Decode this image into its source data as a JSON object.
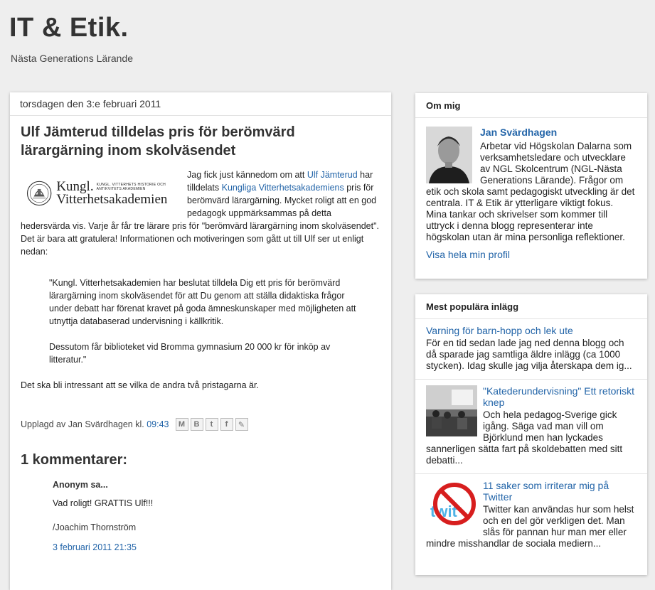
{
  "blog": {
    "title": "IT & Etik.",
    "description": "Nästa Generations Lärande"
  },
  "post": {
    "date": "torsdagen den 3:e februari 2011",
    "title": "Ulf Jämterud tilldelas pris för berömvärd lärargärning inom skolväsendet",
    "logo": {
      "line1": "Kungl.",
      "line1_small": "KUNGL. VITTERHETS HISTORIE OCH ANTIKVITETS AKADEMIEN",
      "line2": "Vitterhetsakademien"
    },
    "intro_1": "Jag fick just kännedom om att ",
    "link_ulf": "Ulf Jämterud",
    "intro_2": " har tilldelats ",
    "link_akademien": "Kungliga Vitterhetsakademiens",
    "intro_3": " pris för berömvärd lärargärning. Mycket roligt att en god pedagogk uppmärksammas på detta hedersvärda vis. Varje år får tre lärare pris för \"berömvärd lärargärning inom skolväsendet\". Det är bara att gratulera! Informationen och motiveringen som gått ut till Ulf ser ut enligt nedan:",
    "quote_1": "\"Kungl. Vitterhetsakademien har beslutat tilldela Dig ett pris för berömvärd lärargärning inom skolväsendet för att Du genom att ställa didaktiska frågor under debatt har förenat kravet på goda ämneskunskaper med möjligheten att utnyttja databaserad undervisning i källkritik.",
    "quote_2": "Dessutom får biblioteket vid Bromma gymnasium 20 000 kr för inköp av litteratur.\"",
    "after_quote": "Det ska bli intressant att se vilka de andra två pristagarna är.",
    "footer_prefix": "Upplagd av Jan Svärdhagen kl.",
    "footer_time": "09:43",
    "share_icons": [
      "email-icon",
      "blogthis-icon",
      "twitter-icon",
      "facebook-icon",
      "buzz-icon"
    ]
  },
  "comments": {
    "title": "1 kommentarer:",
    "items": [
      {
        "author": "Anonym sa...",
        "body": "Vad roligt! GRATTIS Ulf!!!",
        "signature": "/Joachim Thornström",
        "timestamp": "3 februari 2011 21:35"
      }
    ]
  },
  "sidebar": {
    "about": {
      "title": "Om mig",
      "name": "Jan Svärdhagen",
      "text": "Arbetar vid Högskolan Dalarna som verksamhetsledare och utvecklare av NGL Skolcentrum (NGL-Nästa Generations Lärande). Frågor om etik och skola samt pedagogiskt utveckling är det centrala. IT & Etik är ytterligare viktigt fokus. Mina tankar och skrivelser som kommer till uttryck i denna blogg representerar inte högskolan utan är mina personliga reflektioner.",
      "profile_link": "Visa hela min profil"
    },
    "popular": {
      "title": "Mest populära inlägg",
      "items": [
        {
          "title": "Varning för barn-hopp och lek ute",
          "snippet": "För en tid sedan lade jag ned denna blogg och då sparade jag samtliga äldre inlägg (ca 1000 stycken). Idag skulle jag vilja återskapa dem ig..."
        },
        {
          "title": "\"Katederundervisning\" Ett retoriskt knep",
          "snippet": "Och hela pedagog-Sverige gick igång. Säga vad man vill om Björklund men han lyckades sannerligen sätta fart på skoldebatten med sitt debatti..."
        },
        {
          "title": "11 saker som irriterar mig på Twitter",
          "snippet": "Twitter kan användas hur som helst och en del gör verkligen det. Man slås för pannan hur man mer eller mindre misshandlar de sociala mediern..."
        }
      ]
    }
  }
}
